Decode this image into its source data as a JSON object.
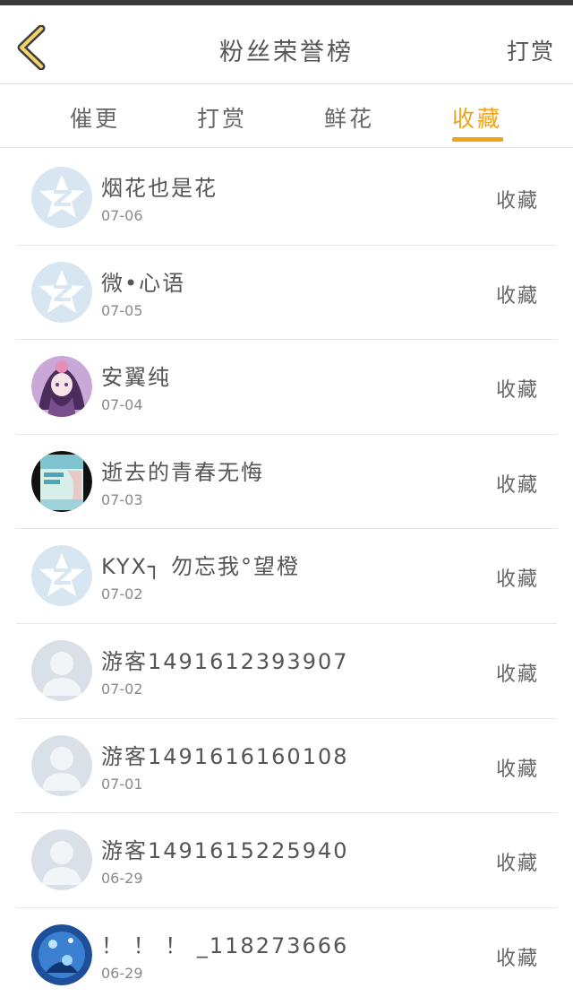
{
  "header": {
    "title": "粉丝荣誉榜",
    "reward_label": "打赏"
  },
  "tabs": [
    {
      "label": "催更"
    },
    {
      "label": "打赏"
    },
    {
      "label": "鲜花"
    },
    {
      "label": "收藏"
    }
  ],
  "colors": {
    "accent": "#f0a318",
    "default_avatar": "#d7e6f0",
    "person_avatar": "#d9e0e8"
  },
  "list": [
    {
      "name": "烟花也是花",
      "date": "07-06",
      "action": "收藏",
      "avatar": "qq-default-icon"
    },
    {
      "name": "微•心语",
      "date": "07-05",
      "action": "收藏",
      "avatar": "qq-default-icon"
    },
    {
      "name": "安翼纯",
      "date": "07-04",
      "action": "收藏",
      "avatar": "anime-girl-avatar"
    },
    {
      "name": "逝去的青春无悔",
      "date": "07-03",
      "action": "收藏",
      "avatar": "book-cover-avatar"
    },
    {
      "name": "KYX┐ 勿忘我°望橙",
      "date": "07-02",
      "action": "收藏",
      "avatar": "qq-default-icon"
    },
    {
      "name": "游客1491612393907",
      "date": "07-02",
      "action": "收藏",
      "avatar": "person-placeholder-icon"
    },
    {
      "name": "游客1491616160108",
      "date": "07-01",
      "action": "收藏",
      "avatar": "person-placeholder-icon"
    },
    {
      "name": "游客1491615225940",
      "date": "06-29",
      "action": "收藏",
      "avatar": "person-placeholder-icon"
    },
    {
      "name": "！ ！ ！ _118273666",
      "date": "06-29",
      "action": "收藏",
      "avatar": "blue-scene-avatar"
    }
  ]
}
